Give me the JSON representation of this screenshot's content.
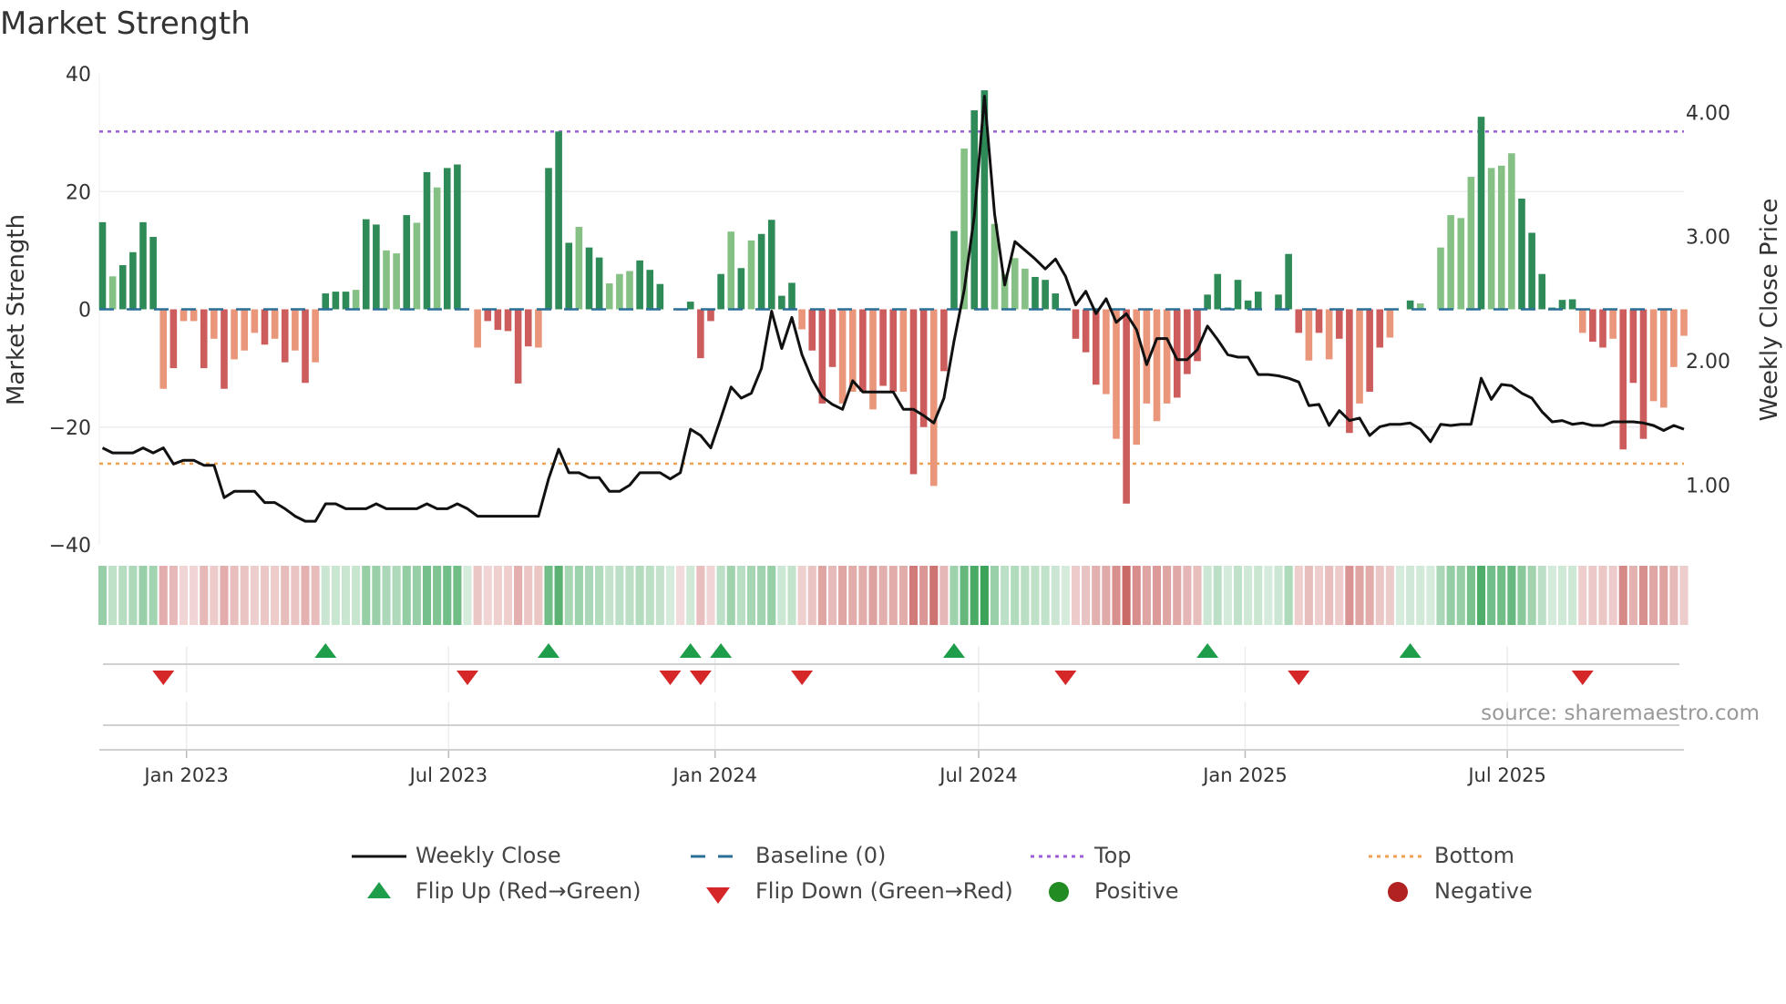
{
  "title": "Market Strength",
  "source": "source: sharemaestro.com",
  "colors": {
    "bar_pos_dark": "#2e8b57",
    "bar_pos_light": "#85c185",
    "bar_neg_dark": "#cd5c5c",
    "bar_neg_light": "#e9967a",
    "line": "#111111",
    "baseline": "#2a6f97",
    "top": "#9a5fd6",
    "bottom": "#f0a050",
    "flip_up": "#1e9e4a",
    "flip_down": "#d62728",
    "positive": "#228b22",
    "negative": "#b22222",
    "strip_pos": "#2e9e4e",
    "strip_neg": "#c0504d"
  },
  "chart_data": {
    "type": "bar",
    "title": "Market Strength",
    "ylabel": "Market Strength",
    "y2label": "Weekly Close Price",
    "ylim": [
      -40,
      40
    ],
    "y2lim": [
      0.52,
      4.31
    ],
    "yticks": [
      "40",
      "20",
      "0",
      "−20",
      "−40"
    ],
    "ytick_values": [
      40,
      20,
      0,
      -20,
      -40
    ],
    "y2ticks": [
      "4.00",
      "3.00",
      "2.00",
      "1.00"
    ],
    "y2tick_values": [
      4,
      3,
      2,
      1
    ],
    "start_date": "2022-11-04",
    "interval": "weekly",
    "xticks": [
      {
        "label": "Jan 2023",
        "date": "2023-01-01"
      },
      {
        "label": "Jul 2023",
        "date": "2023-07-01"
      },
      {
        "label": "Jan 2024",
        "date": "2024-01-01"
      },
      {
        "label": "Jul 2024",
        "date": "2024-07-01"
      },
      {
        "label": "Jan 2025",
        "date": "2025-01-01"
      },
      {
        "label": "Jul 2025",
        "date": "2025-07-01"
      }
    ],
    "top_level": 30.2,
    "bottom_level": -26.2,
    "baseline": 0,
    "strength": [
      14.8,
      5.6,
      7.5,
      9.7,
      14.8,
      12.3,
      -13.5,
      -10,
      -2,
      -2,
      -10,
      -5,
      -13.5,
      -8.5,
      -7,
      -4,
      -6,
      -5,
      -9,
      -7,
      -12.5,
      -9,
      2.7,
      3,
      3,
      3.3,
      15.3,
      14.4,
      10,
      9.5,
      16,
      14.7,
      23.3,
      20.7,
      24,
      24.6,
      0,
      -6.5,
      -2,
      -3.5,
      -3.7,
      -12.6,
      -6.3,
      -6.5,
      24,
      30.2,
      11.3,
      14,
      10.5,
      8.8,
      4.4,
      6,
      6.5,
      8.3,
      6.7,
      4.3,
      0,
      -0.2,
      1.3,
      -8.3,
      -2,
      6,
      13.2,
      7,
      11.7,
      12.8,
      15.2,
      2.3,
      4.5,
      -3.4,
      -7,
      -16,
      -9.8,
      -16,
      -14,
      -14,
      -17,
      -13,
      -14,
      -14,
      -28,
      -20,
      -30,
      -10.5,
      13.3,
      27.3,
      33.8,
      37.2,
      14.5,
      6,
      8.7,
      6.9,
      5.5,
      5,
      2.7,
      0,
      -5,
      -7.3,
      -12.8,
      -14.4,
      -22,
      -33,
      -23,
      -16,
      -19,
      -16,
      -15,
      -11,
      -8.8,
      2.5,
      6,
      0.3,
      5,
      1.5,
      3,
      0,
      2.5,
      9.4,
      -4,
      -8.7,
      -4,
      -8.5,
      -5,
      -21,
      -16,
      -14,
      -6.5,
      -4.8,
      0,
      1.5,
      1,
      0,
      10.5,
      16,
      15.5,
      22.5,
      32.7,
      24,
      24.4,
      26.5,
      18.8,
      13,
      6,
      0.3,
      1.6,
      1.7,
      -4,
      -5.5,
      -6.5,
      -5,
      -23.8,
      -12.5,
      -22,
      -15.6,
      -16.7,
      -9.8,
      -4.5
    ],
    "strength_shade": "dlddddldlldldllldldldldddlddlldldldddldddddldddlddllldddllddddldlddddldddlldlddlddlddlddlllldddddddlldlllldddddddddddddldlddlddlddldlllldlllddddddlddldddlllldlddldlldlldlddddddlddl",
    "close": [
      1.3,
      1.26,
      1.26,
      1.26,
      1.3,
      1.26,
      1.3,
      1.17,
      1.2,
      1.2,
      1.16,
      1.16,
      0.9,
      0.95,
      0.95,
      0.95,
      0.86,
      0.86,
      0.81,
      0.75,
      0.71,
      0.71,
      0.85,
      0.85,
      0.81,
      0.81,
      0.81,
      0.85,
      0.81,
      0.81,
      0.81,
      0.81,
      0.85,
      0.81,
      0.81,
      0.85,
      0.81,
      0.75,
      0.75,
      0.75,
      0.75,
      0.75,
      0.75,
      0.75,
      1.05,
      1.29,
      1.1,
      1.1,
      1.06,
      1.06,
      0.95,
      0.95,
      1.0,
      1.1,
      1.1,
      1.1,
      1.05,
      1.1,
      1.45,
      1.4,
      1.3,
      1.54,
      1.79,
      1.7,
      1.74,
      1.94,
      2.4,
      2.1,
      2.35,
      2.05,
      1.85,
      1.71,
      1.65,
      1.61,
      1.84,
      1.75,
      1.75,
      1.75,
      1.75,
      1.61,
      1.61,
      1.56,
      1.5,
      1.7,
      2.16,
      2.57,
      3.17,
      4.13,
      3.18,
      2.61,
      2.96,
      2.89,
      2.82,
      2.74,
      2.82,
      2.68,
      2.45,
      2.56,
      2.38,
      2.5,
      2.31,
      2.38,
      2.25,
      1.97,
      2.18,
      2.18,
      2.01,
      2.01,
      2.09,
      2.28,
      2.17,
      2.05,
      2.03,
      2.03,
      1.89,
      1.89,
      1.88,
      1.86,
      1.83,
      1.64,
      1.65,
      1.48,
      1.6,
      1.52,
      1.54,
      1.4,
      1.47,
      1.49,
      1.49,
      1.5,
      1.45,
      1.35,
      1.49,
      1.48,
      1.49,
      1.49,
      1.86,
      1.69,
      1.81,
      1.8,
      1.74,
      1.7,
      1.59,
      1.51,
      1.52,
      1.49,
      1.5,
      1.48,
      1.48,
      1.51,
      1.51,
      1.51,
      1.5,
      1.48,
      1.44,
      1.48,
      1.45
    ],
    "flip_up_weeks": [
      22,
      44,
      58,
      61,
      84,
      109,
      129
    ],
    "flip_down_weeks": [
      6,
      36,
      56,
      59,
      69,
      95,
      118,
      146
    ],
    "legend": {
      "weekly_close": "Weekly Close",
      "baseline": "Baseline (0)",
      "top": "Top",
      "bottom": "Bottom",
      "flip_up": "Flip Up (Red→Green)",
      "flip_down": "Flip Down (Green→Red)",
      "positive": "Positive",
      "negative": "Negative"
    },
    "legend_position": "bottom"
  }
}
